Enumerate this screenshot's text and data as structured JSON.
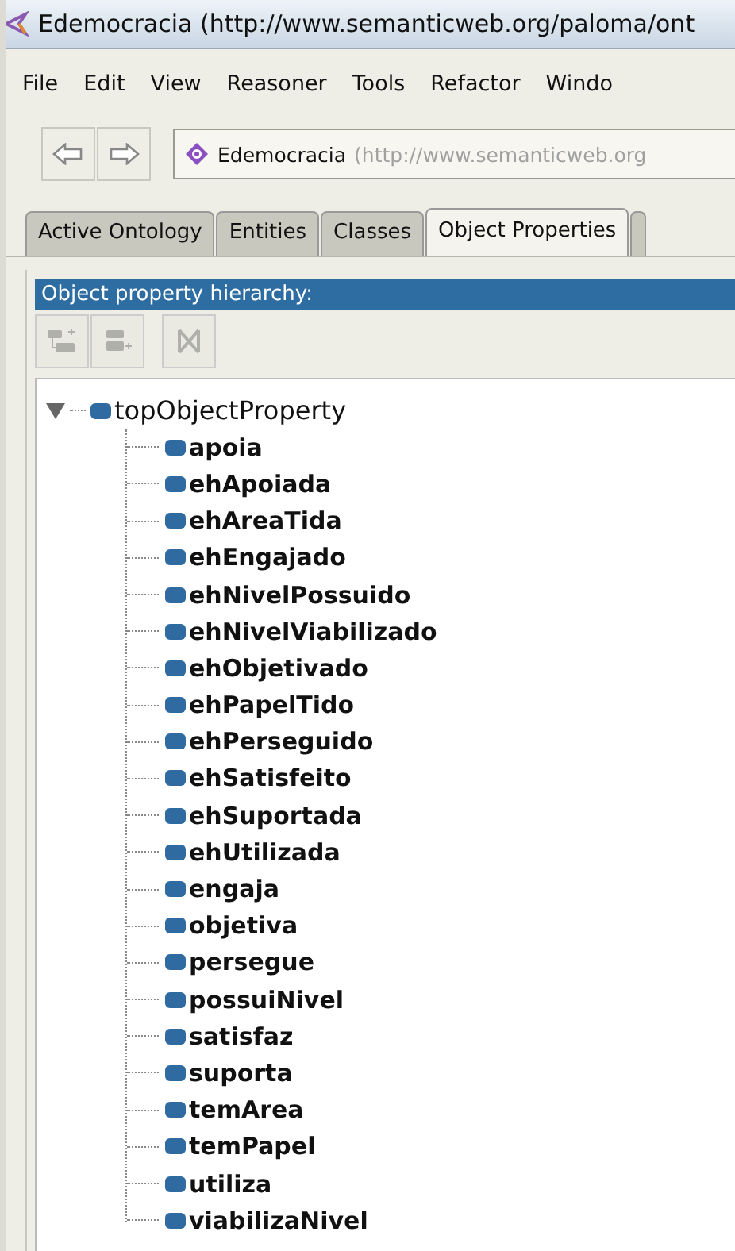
{
  "window": {
    "title": "Edemocracia (http://www.semanticweb.org/paloma/ont"
  },
  "menu": [
    "File",
    "Edit",
    "View",
    "Reasoner",
    "Tools",
    "Refactor",
    "Windo"
  ],
  "navigation": {
    "ontology_name": "Edemocracia",
    "ontology_iri": "(http://www.semanticweb.org"
  },
  "tabs": [
    {
      "label": "Active Ontology",
      "selected": false
    },
    {
      "label": "Entities",
      "selected": false
    },
    {
      "label": "Classes",
      "selected": false
    },
    {
      "label": "Object Properties",
      "selected": true
    }
  ],
  "panel": {
    "title": "Object property hierarchy:",
    "tools": [
      {
        "kind": "add-sub",
        "disabled": true
      },
      {
        "kind": "add-sibling",
        "disabled": true
      },
      {
        "kind": "delete",
        "disabled": true
      }
    ]
  },
  "tree": {
    "label": "topObjectProperty",
    "bold": false,
    "expanded": true,
    "children": [
      {
        "label": "apoia",
        "bold": true
      },
      {
        "label": "ehApoiada",
        "bold": true
      },
      {
        "label": "ehAreaTida",
        "bold": true
      },
      {
        "label": "ehEngajado",
        "bold": true
      },
      {
        "label": "ehNivelPossuido",
        "bold": true
      },
      {
        "label": "ehNivelViabilizado",
        "bold": true
      },
      {
        "label": "ehObjetivado",
        "bold": true
      },
      {
        "label": "ehPapelTido",
        "bold": true
      },
      {
        "label": "ehPerseguido",
        "bold": true
      },
      {
        "label": "ehSatisfeito",
        "bold": true
      },
      {
        "label": "ehSuportada",
        "bold": true
      },
      {
        "label": "ehUtilizada",
        "bold": true
      },
      {
        "label": "engaja",
        "bold": true
      },
      {
        "label": "objetiva",
        "bold": true
      },
      {
        "label": "persegue",
        "bold": true
      },
      {
        "label": "possuiNivel",
        "bold": true
      },
      {
        "label": "satisfaz",
        "bold": true
      },
      {
        "label": "suporta",
        "bold": true
      },
      {
        "label": "temArea",
        "bold": true
      },
      {
        "label": "temPapel",
        "bold": true
      },
      {
        "label": "utiliza",
        "bold": true
      },
      {
        "label": "viabilizaNivel",
        "bold": true
      }
    ]
  }
}
